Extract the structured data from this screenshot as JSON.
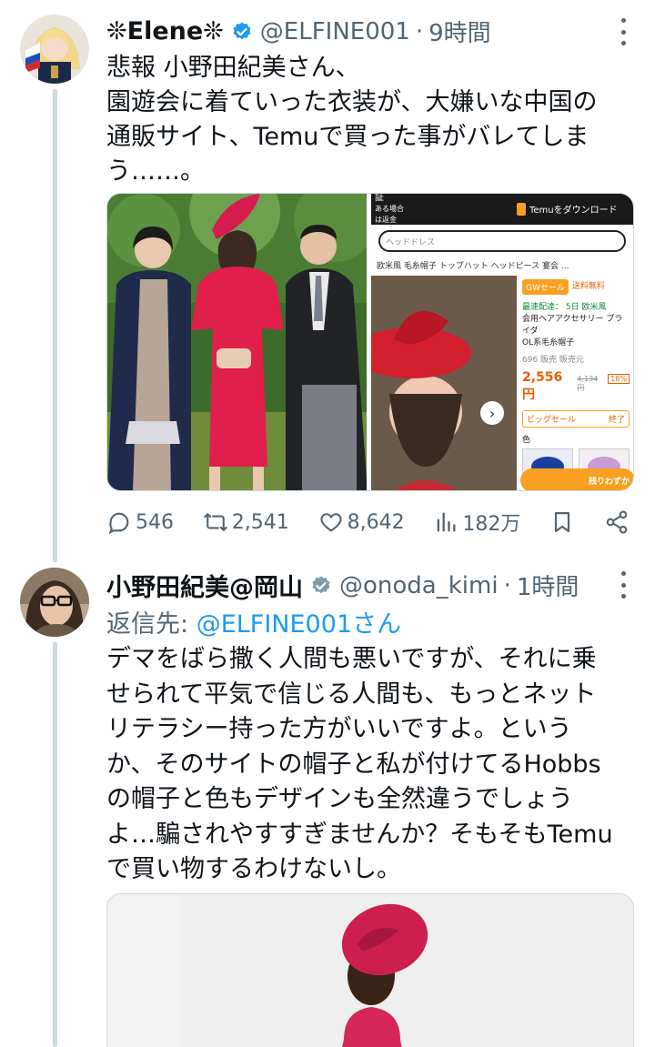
{
  "tweets": [
    {
      "name": "❊Elene❊",
      "handle": "@ELFINE001",
      "sep": "·",
      "time": "9時間",
      "text": "悲報 小野田紀美さん、\n園遊会に着ていった衣装が、大嫌いな中国の\n通販サイト、Temuで買った事がバレてしま\nう……。",
      "media_left_icon": "photo-three-people",
      "media_right": {
        "download_label": "Temuをダウンロード",
        "search_placeholder": "ヘッドドレス",
        "product_title": "欧米風 毛糸帽子 トップハット ヘッドピース 宴会 ...",
        "sale_tag": "GWセール",
        "shipping_tag": "送料無料",
        "promo": "最速配達： 5日 欧米風",
        "desc_line1": "会用ヘアアクセサリー ブライダ",
        "desc_line2": "OL系毛糸帽子",
        "sold": "696 販売",
        "seller": "販売元",
        "price": "2,556円",
        "old_price": "4,134円",
        "discount": "18%",
        "big_sale": "ビッグセール",
        "ends": "終了",
        "color_label": "色",
        "remaining": "残りわずか",
        "top_left_1": "証",
        "top_left_2": "ある場合は返金"
      },
      "stats": {
        "replies": "546",
        "retweets": "2,541",
        "likes": "8,642",
        "views": "182万"
      },
      "colors": {
        "like": "#536471",
        "link": "#1d9bf0"
      }
    },
    {
      "name": "小野田紀美@岡山",
      "handle": "@onoda_kimi",
      "sep": "·",
      "time": "1時間",
      "replying_label": "返信先:",
      "replying_to": "@ELFINE001さん",
      "text": "デマをばら撒く人間も悪いですが、それに乗\nせられて平気で信じる人間も、もっとネット\nリテラシー持った方がいいですよ。という\nか、そのサイトの帽子と私が付けてるHobbs\nの帽子と色もデザインも全然違うでしょう\nよ…騙されやすすぎませんか？そもそもTemu\nで買い物するわけないし。"
    }
  ],
  "verified_badge_colors": {
    "blue": "#1d9bf0",
    "gray": "#829aab"
  }
}
